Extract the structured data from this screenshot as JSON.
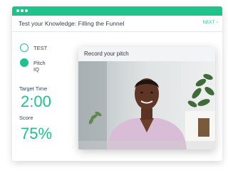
{
  "window": {
    "title": "Test your Knowledge: Filling the Funnel",
    "next_label": "NEXT",
    "next_icon": "chevron-right-icon"
  },
  "options": [
    {
      "label": "TEST",
      "selected": false
    },
    {
      "label": "Pitch IQ",
      "selected": true
    }
  ],
  "metrics": {
    "target_time_label": "Target Time",
    "target_time_value": "2:00",
    "score_label": "Score",
    "score_value": "75%"
  },
  "pitch_panel": {
    "title": "Record your pitch"
  },
  "colors": {
    "accent": "#1ec38c",
    "title_text": "#3a4250"
  }
}
